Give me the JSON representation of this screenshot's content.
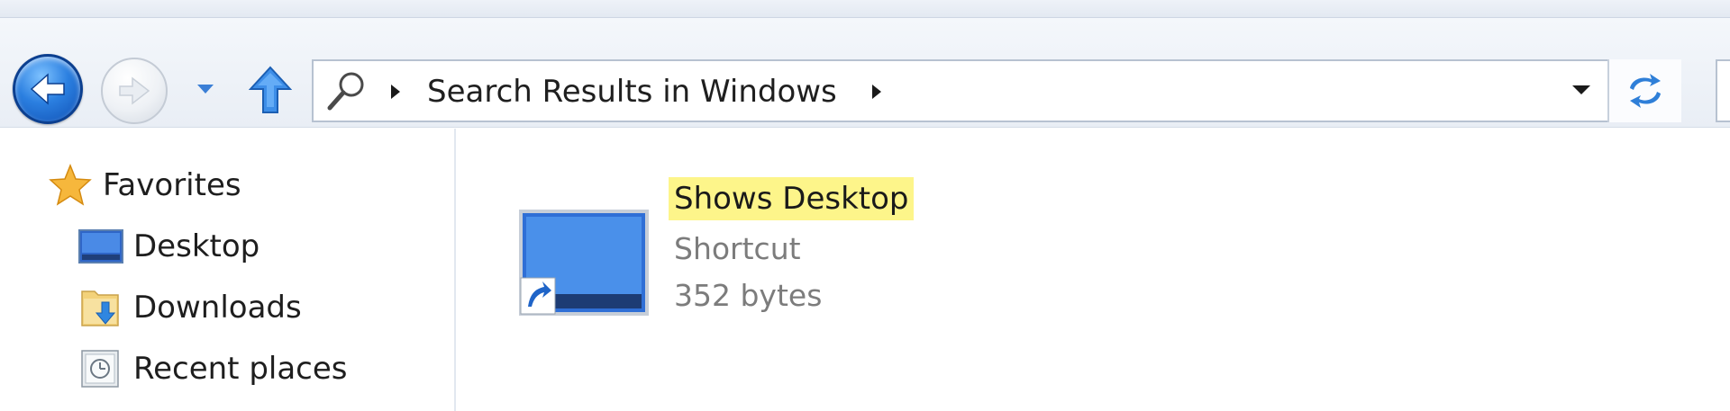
{
  "address_bar": {
    "path_text": "Search Results in Windows"
  },
  "navigation_pane": {
    "items": [
      {
        "label": "Favorites",
        "icon": "star-icon"
      },
      {
        "label": "Desktop",
        "icon": "desktop-icon"
      },
      {
        "label": "Downloads",
        "icon": "downloads-folder-icon"
      },
      {
        "label": "Recent places",
        "icon": "recent-places-icon"
      }
    ]
  },
  "results": [
    {
      "name": "Shows Desktop",
      "type": "Shortcut",
      "size": "352 bytes",
      "icon": "desktop-shortcut-icon",
      "highlight_color": "#fdf58a"
    }
  ],
  "colors": {
    "accent": "#2b7fe0",
    "secondary_text": "#7c7c7c"
  }
}
